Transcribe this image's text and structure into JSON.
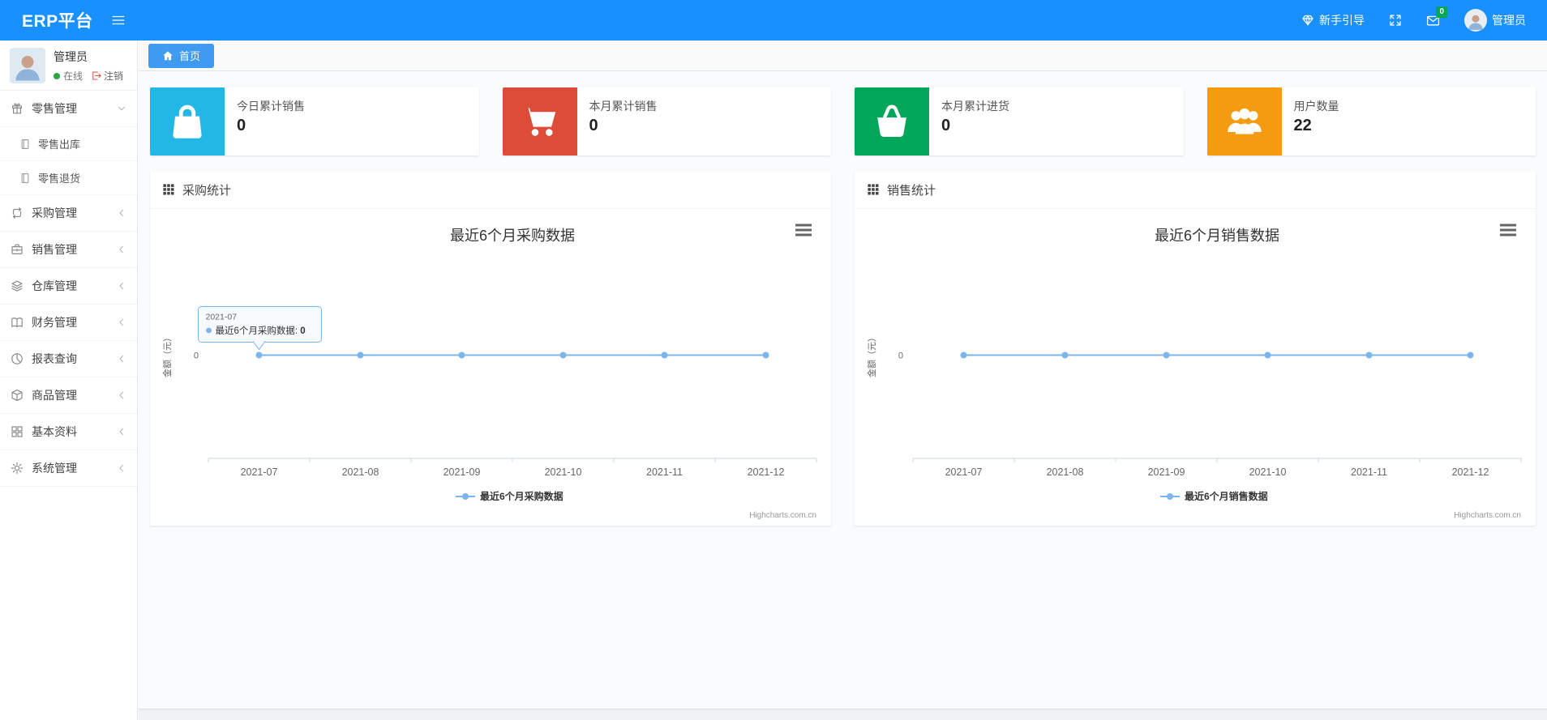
{
  "header": {
    "brand": "ERP平台",
    "guide_label": "新手引导",
    "mail_badge": "0",
    "user_name": "管理员"
  },
  "sidebar": {
    "user": {
      "name": "管理员",
      "status": "在线",
      "logout": "注销"
    },
    "menu": [
      {
        "label": "零售管理",
        "icon": "gift-icon",
        "state": "expanded",
        "children": [
          {
            "label": "零售出库",
            "icon": "file-icon"
          },
          {
            "label": "零售退货",
            "icon": "file-icon"
          }
        ]
      },
      {
        "label": "采购管理",
        "icon": "repeat-icon"
      },
      {
        "label": "销售管理",
        "icon": "briefcase-icon"
      },
      {
        "label": "仓库管理",
        "icon": "layers-icon"
      },
      {
        "label": "财务管理",
        "icon": "book-icon"
      },
      {
        "label": "报表查询",
        "icon": "pie-chart-icon"
      },
      {
        "label": "商品管理",
        "icon": "box-icon"
      },
      {
        "label": "基本资料",
        "icon": "grid-icon"
      },
      {
        "label": "系统管理",
        "icon": "gear-icon"
      }
    ]
  },
  "breadcrumb": {
    "home_label": "首页",
    "icon": "home-icon"
  },
  "stat_cards": [
    {
      "label": "今日累计销售",
      "value": "0",
      "color": "#23b7e5",
      "icon": "shopping-bag-icon"
    },
    {
      "label": "本月累计销售",
      "value": "0",
      "color": "#dd4b39",
      "icon": "cart-icon"
    },
    {
      "label": "本月累计进货",
      "value": "0",
      "color": "#00a65a",
      "icon": "basket-icon"
    },
    {
      "label": "用户数量",
      "value": "22",
      "color": "#f39c12",
      "icon": "users-icon"
    }
  ],
  "panels": [
    {
      "title": "采购统计",
      "icon": "grid-dots-icon"
    },
    {
      "title": "销售统计",
      "icon": "grid-dots-icon"
    }
  ],
  "chart_data": [
    {
      "type": "line",
      "title": "最近6个月采购数据",
      "categories": [
        "2021-07",
        "2021-08",
        "2021-09",
        "2021-10",
        "2021-11",
        "2021-12"
      ],
      "series": [
        {
          "name": "最近6个月采购数据",
          "values": [
            0,
            0,
            0,
            0,
            0,
            0
          ],
          "color": "#7cb5ec"
        }
      ],
      "xlabel": "",
      "ylabel": "金额（元）",
      "ylim": [
        -1,
        1
      ],
      "yticks": [
        0
      ],
      "grid": false,
      "legend_position": "bottom",
      "credit": "Highcharts.com.cn",
      "tooltip": {
        "header": "2021-07",
        "series": "最近6个月采购数据",
        "value": "0",
        "point_index": 0
      }
    },
    {
      "type": "line",
      "title": "最近6个月销售数据",
      "categories": [
        "2021-07",
        "2021-08",
        "2021-09",
        "2021-10",
        "2021-11",
        "2021-12"
      ],
      "series": [
        {
          "name": "最近6个月销售数据",
          "values": [
            0,
            0,
            0,
            0,
            0,
            0
          ],
          "color": "#7cb5ec"
        }
      ],
      "xlabel": "",
      "ylabel": "金额（元）",
      "ylim": [
        -1,
        1
      ],
      "yticks": [
        0
      ],
      "grid": false,
      "legend_position": "bottom",
      "credit": "Highcharts.com.cn"
    }
  ]
}
